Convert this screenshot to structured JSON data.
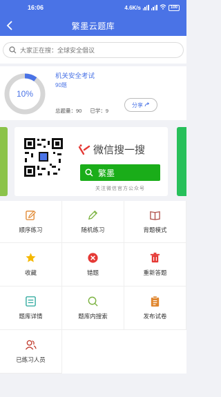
{
  "status_bar": {
    "time": "16:06",
    "speed": "4.6K/s",
    "battery": "100"
  },
  "nav": {
    "title": "繁墨云题库"
  },
  "search": {
    "text": "大家正在搜：全球安全倡议"
  },
  "exam": {
    "progress_percent": 10,
    "progress_label": "10%",
    "title": "机关安全考试",
    "count": "90题",
    "total_label": "总题量：90",
    "done_label": "已学：9",
    "share_label": "分享"
  },
  "banner": {
    "wechat_text": "微信搜一搜",
    "search_term": "繁墨",
    "follow_text": "关注微信官方公众号"
  },
  "menu": [
    {
      "label": "顺序练习",
      "icon": "edit-square-icon",
      "color": "#e0862e"
    },
    {
      "label": "随机练习",
      "icon": "pencil-icon",
      "color": "#7cb342"
    },
    {
      "label": "背题模式",
      "icon": "book-icon",
      "color": "#b0504a"
    },
    {
      "label": "收藏",
      "icon": "star-icon",
      "color": "#f5b800"
    },
    {
      "label": "错题",
      "icon": "error-circle-icon",
      "color": "#e53935"
    },
    {
      "label": "重新答题",
      "icon": "trash-icon",
      "color": "#e53935"
    },
    {
      "label": "题库详情",
      "icon": "detail-icon",
      "color": "#26a69a"
    },
    {
      "label": "题库内搜索",
      "icon": "search-icon",
      "color": "#7cb342"
    },
    {
      "label": "发布试卷",
      "icon": "clipboard-icon",
      "color": "#e0862e"
    },
    {
      "label": "已练习人员",
      "icon": "users-icon",
      "color": "#c0392b"
    }
  ]
}
